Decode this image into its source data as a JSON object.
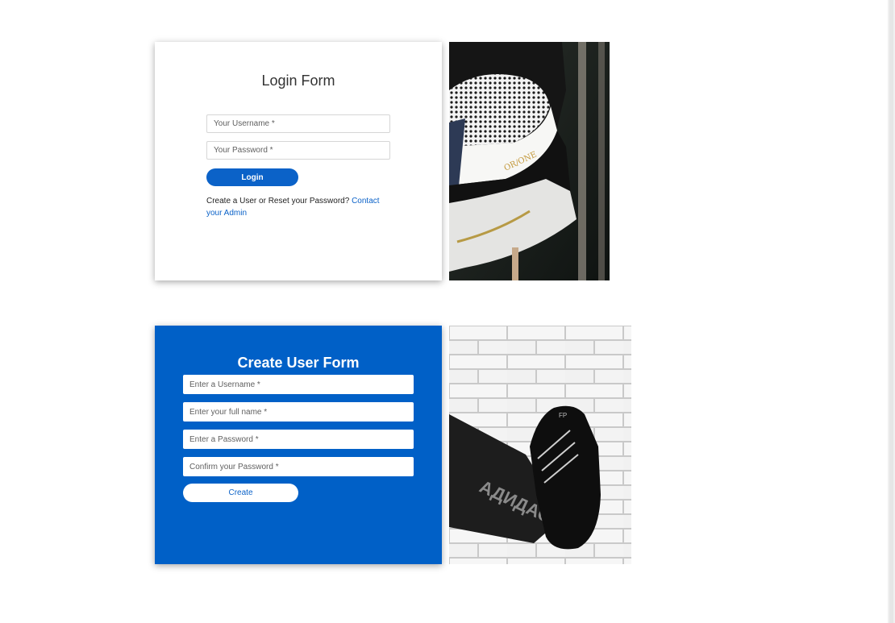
{
  "login": {
    "title": "Login Form",
    "username_placeholder": "Your Username *",
    "password_placeholder": "Your Password *",
    "submit_label": "Login",
    "help_text": "Create a User or Reset your Password?",
    "help_link": "Contact your Admin"
  },
  "create_user": {
    "title": "Create User Form",
    "username_placeholder": "Enter a Username *",
    "fullname_placeholder": "Enter your full name *",
    "password_placeholder": "Enter a Password *",
    "confirm_placeholder": "Confirm your Password *",
    "submit_label": "Create"
  },
  "images": {
    "login_photo": "sneaker-closeup-photo",
    "create_photo": "sneaker-against-brick-wall-photo"
  },
  "colors": {
    "primary": "#0060c7",
    "button": "#0b62c8",
    "link": "#0b62c8"
  }
}
